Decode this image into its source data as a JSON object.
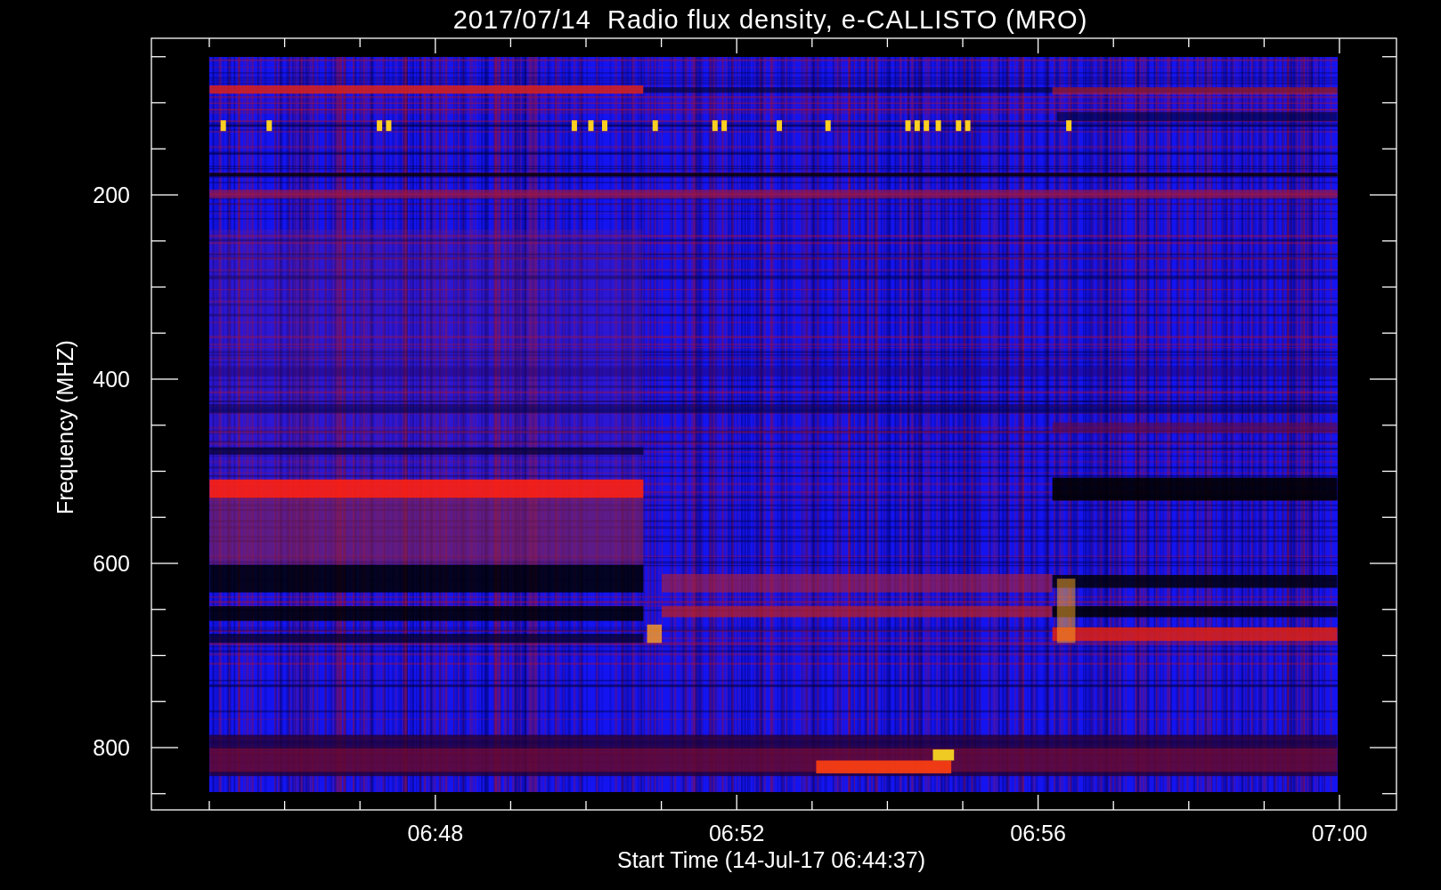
{
  "title": "2017/07/14  Radio flux density, e-CALLISTO (MRO)",
  "y_axis": {
    "label": "Frequency (MHZ)",
    "ticks": [
      "200",
      "400",
      "600",
      "800"
    ]
  },
  "x_axis": {
    "label": "Start Time (14-Jul-17 06:44:37)",
    "ticks": [
      "06:48",
      "06:52",
      "06:56",
      "07:00"
    ]
  }
}
